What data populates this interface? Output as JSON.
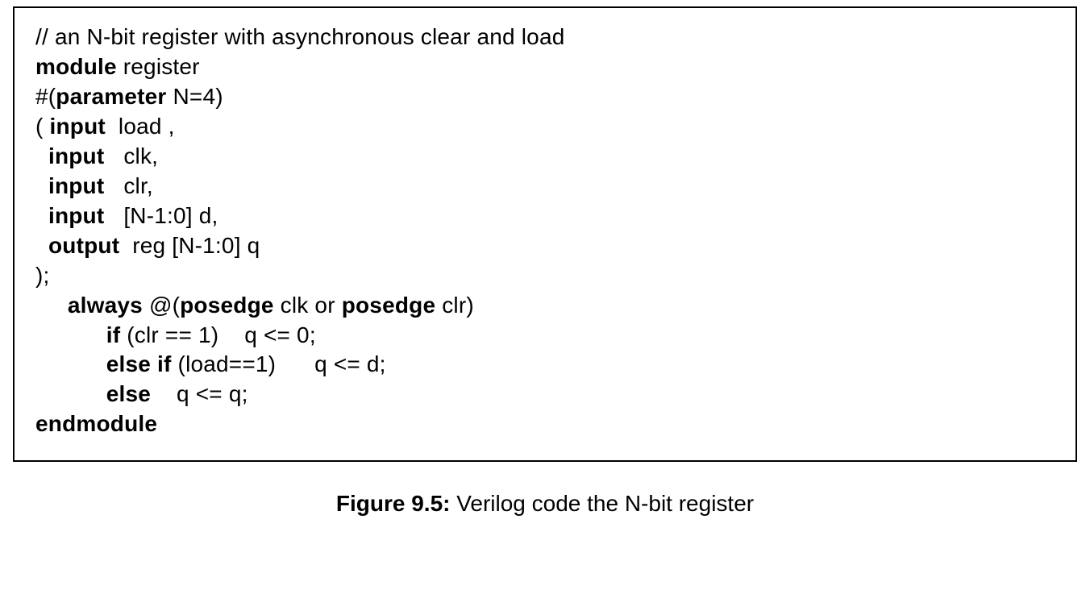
{
  "code": {
    "lines": [
      {
        "segments": [
          {
            "text": "// an N-bit register with asynchronous clear and load"
          }
        ]
      },
      {
        "segments": [
          {
            "text": "module",
            "bold": true
          },
          {
            "text": " register"
          }
        ]
      },
      {
        "segments": [
          {
            "text": "#("
          },
          {
            "text": "parameter",
            "bold": true
          },
          {
            "text": " N=4)"
          }
        ]
      },
      {
        "segments": [
          {
            "text": "( "
          },
          {
            "text": "input",
            "bold": true
          },
          {
            "text": "  load ,"
          }
        ]
      },
      {
        "segments": [
          {
            "text": "  "
          },
          {
            "text": "input",
            "bold": true
          },
          {
            "text": "   clk,"
          }
        ]
      },
      {
        "segments": [
          {
            "text": "  "
          },
          {
            "text": "input",
            "bold": true
          },
          {
            "text": "   clr,"
          }
        ]
      },
      {
        "segments": [
          {
            "text": "  "
          },
          {
            "text": "input",
            "bold": true
          },
          {
            "text": "   [N-1:0] d,"
          }
        ]
      },
      {
        "segments": [
          {
            "text": "  "
          },
          {
            "text": "output",
            "bold": true
          },
          {
            "text": "  reg [N-1:0] q"
          }
        ]
      },
      {
        "segments": [
          {
            "text": ");"
          }
        ]
      },
      {
        "segments": [
          {
            "text": "     "
          },
          {
            "text": "always",
            "bold": true
          },
          {
            "text": " @("
          },
          {
            "text": "posedge",
            "bold": true
          },
          {
            "text": " clk or "
          },
          {
            "text": "posedge",
            "bold": true
          },
          {
            "text": " clr)"
          }
        ]
      },
      {
        "segments": [
          {
            "text": "           "
          },
          {
            "text": "if",
            "bold": true
          },
          {
            "text": " (clr == 1)    q <= 0;"
          }
        ]
      },
      {
        "segments": [
          {
            "text": "           "
          },
          {
            "text": "else if",
            "bold": true
          },
          {
            "text": " (load==1)      q <= d;"
          }
        ]
      },
      {
        "segments": [
          {
            "text": "           "
          },
          {
            "text": "else",
            "bold": true
          },
          {
            "text": "    q <= q;"
          }
        ]
      },
      {
        "segments": [
          {
            "text": "endmodule",
            "bold": true
          }
        ]
      }
    ]
  },
  "caption": {
    "label": "Figure 9.5:",
    "text": " Verilog code the N-bit register"
  }
}
